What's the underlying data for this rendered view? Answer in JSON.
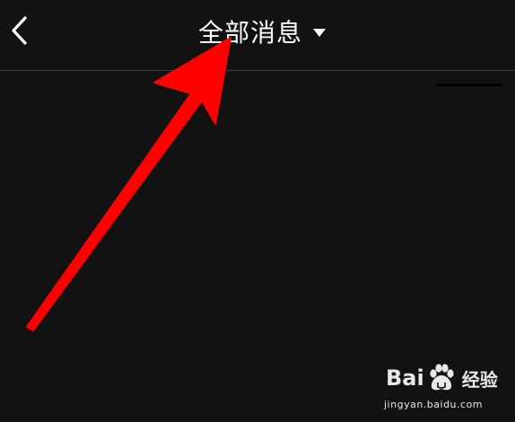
{
  "header": {
    "title": "全部消息",
    "back_icon": "chevron-left-icon",
    "dropdown_icon": "caret-down-icon"
  },
  "annotation": {
    "icon": "red-arrow-annotation",
    "color": "#ff0000"
  },
  "watermark": {
    "brand_left": "Bai",
    "brand_right": "经验",
    "url": "jingyan.baidu.com",
    "icon": "paw-icon"
  },
  "colors": {
    "background": "#121212",
    "text": "#ffffff",
    "divider": "#3a3a3a",
    "annotation": "#ff0000"
  }
}
